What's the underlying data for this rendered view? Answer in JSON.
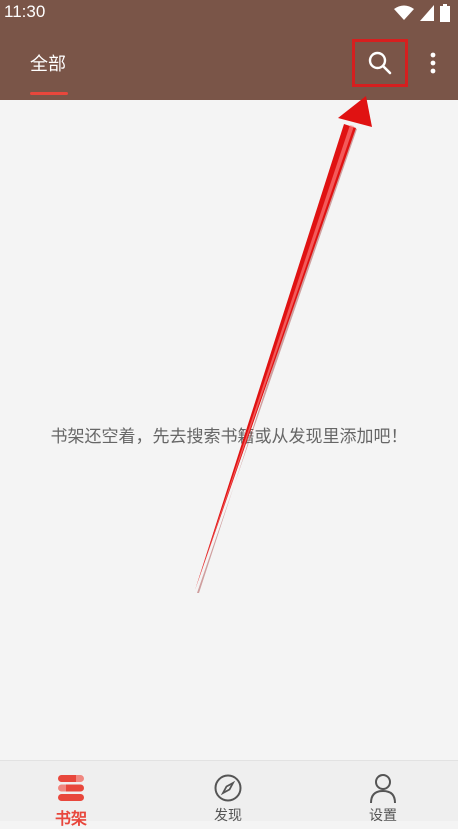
{
  "status_bar": {
    "time": "11:30",
    "icons": [
      "wifi-icon",
      "signal-icon",
      "battery-icon"
    ]
  },
  "app_bar": {
    "tab_label": "全部",
    "search_icon": "search-icon",
    "more_icon": "more-vert-icon",
    "colors": {
      "background": "#7a5548",
      "indicator": "#e8473c",
      "highlight_box": "#d61f1f"
    }
  },
  "main": {
    "empty_message": "书架还空着，先去搜索书籍或从发现里添加吧！"
  },
  "bottom_nav": {
    "items": [
      {
        "label": "书架",
        "icon": "bookshelf-icon",
        "active": true
      },
      {
        "label": "发现",
        "icon": "compass-icon",
        "active": false
      },
      {
        "label": "设置",
        "icon": "person-icon",
        "active": false
      }
    ],
    "active_color": "#e8473c"
  }
}
